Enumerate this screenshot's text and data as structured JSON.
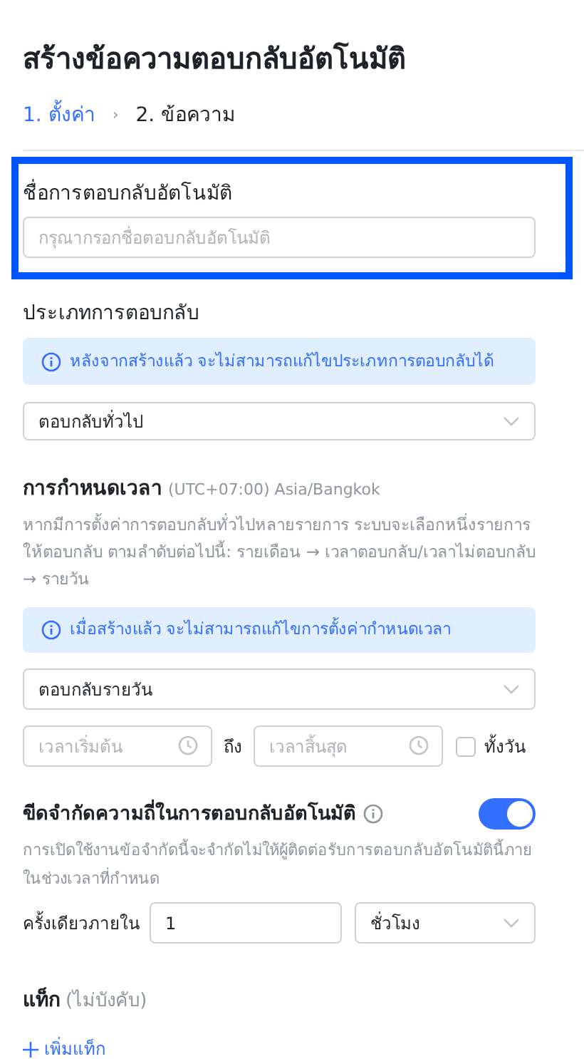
{
  "title": "สร้างข้อความตอบกลับอัตโนมัติ",
  "step_separator": "›",
  "steps": [
    {
      "label": "1. ตั้งค่า",
      "selected": true
    },
    {
      "label": "2. ข้อความ",
      "selected": false
    }
  ],
  "name_section": {
    "label": "ชื่อการตอบกลับอัตโนมัติ",
    "placeholder": "กรุณากรอกชื่อตอบกลับอัตโนมัติ",
    "highlighted": true
  },
  "type_section": {
    "label": "ประเภทการตอบกลับ",
    "notice": "หลังจากสร้างแล้ว จะไม่สามารถแก้ไขประเภทการตอบกลับได้",
    "select_value": "ตอบกลับทั่วไป"
  },
  "schedule_section": {
    "label": "การกำหนดเวลา",
    "timezone": "(UTC+07:00) Asia/Bangkok",
    "description": "หากมีการตั้งค่าการตอบกลับทั่วไปหลายรายการ ระบบจะเลือกหนึ่งรายการให้ตอบกลับ ตามลำดับต่อไปนี้: รายเดือน → เวลาตอบกลับ/เวลาไม่ตอบกลับ → รายวัน",
    "notice": "เมื่อสร้างแล้ว จะไม่สามารถแก้ไขการตั้งค่ากำหนดเวลา",
    "select_value": "ตอบกลับรายวัน",
    "start_placeholder": "เวลาเริ่มต้น",
    "to_label": "ถึง",
    "end_placeholder": "เวลาสิ้นสุด",
    "all_day": {
      "label": "ทั้งวัน",
      "checked": false
    }
  },
  "limit_section": {
    "label": "ขีดจำกัดความถี่ในการตอบกลับอัตโนมัติ",
    "on": true,
    "description": "การเปิดใช้งานข้อจำกัดนี้จะจำกัดไม่ให้ผู้ติดต่อรับการตอบกลับอัตโนมัตินี้ภายในช่วงเวลาที่กำหนด",
    "once_label": "ครั้งเดียวภายใน",
    "amount": "1",
    "unit": "ชั่วโมง"
  },
  "tags_section": {
    "label": "แท็ก",
    "optional": "(ไม่บังคับ)",
    "add_link": "เพิ่มแท็ก"
  }
}
